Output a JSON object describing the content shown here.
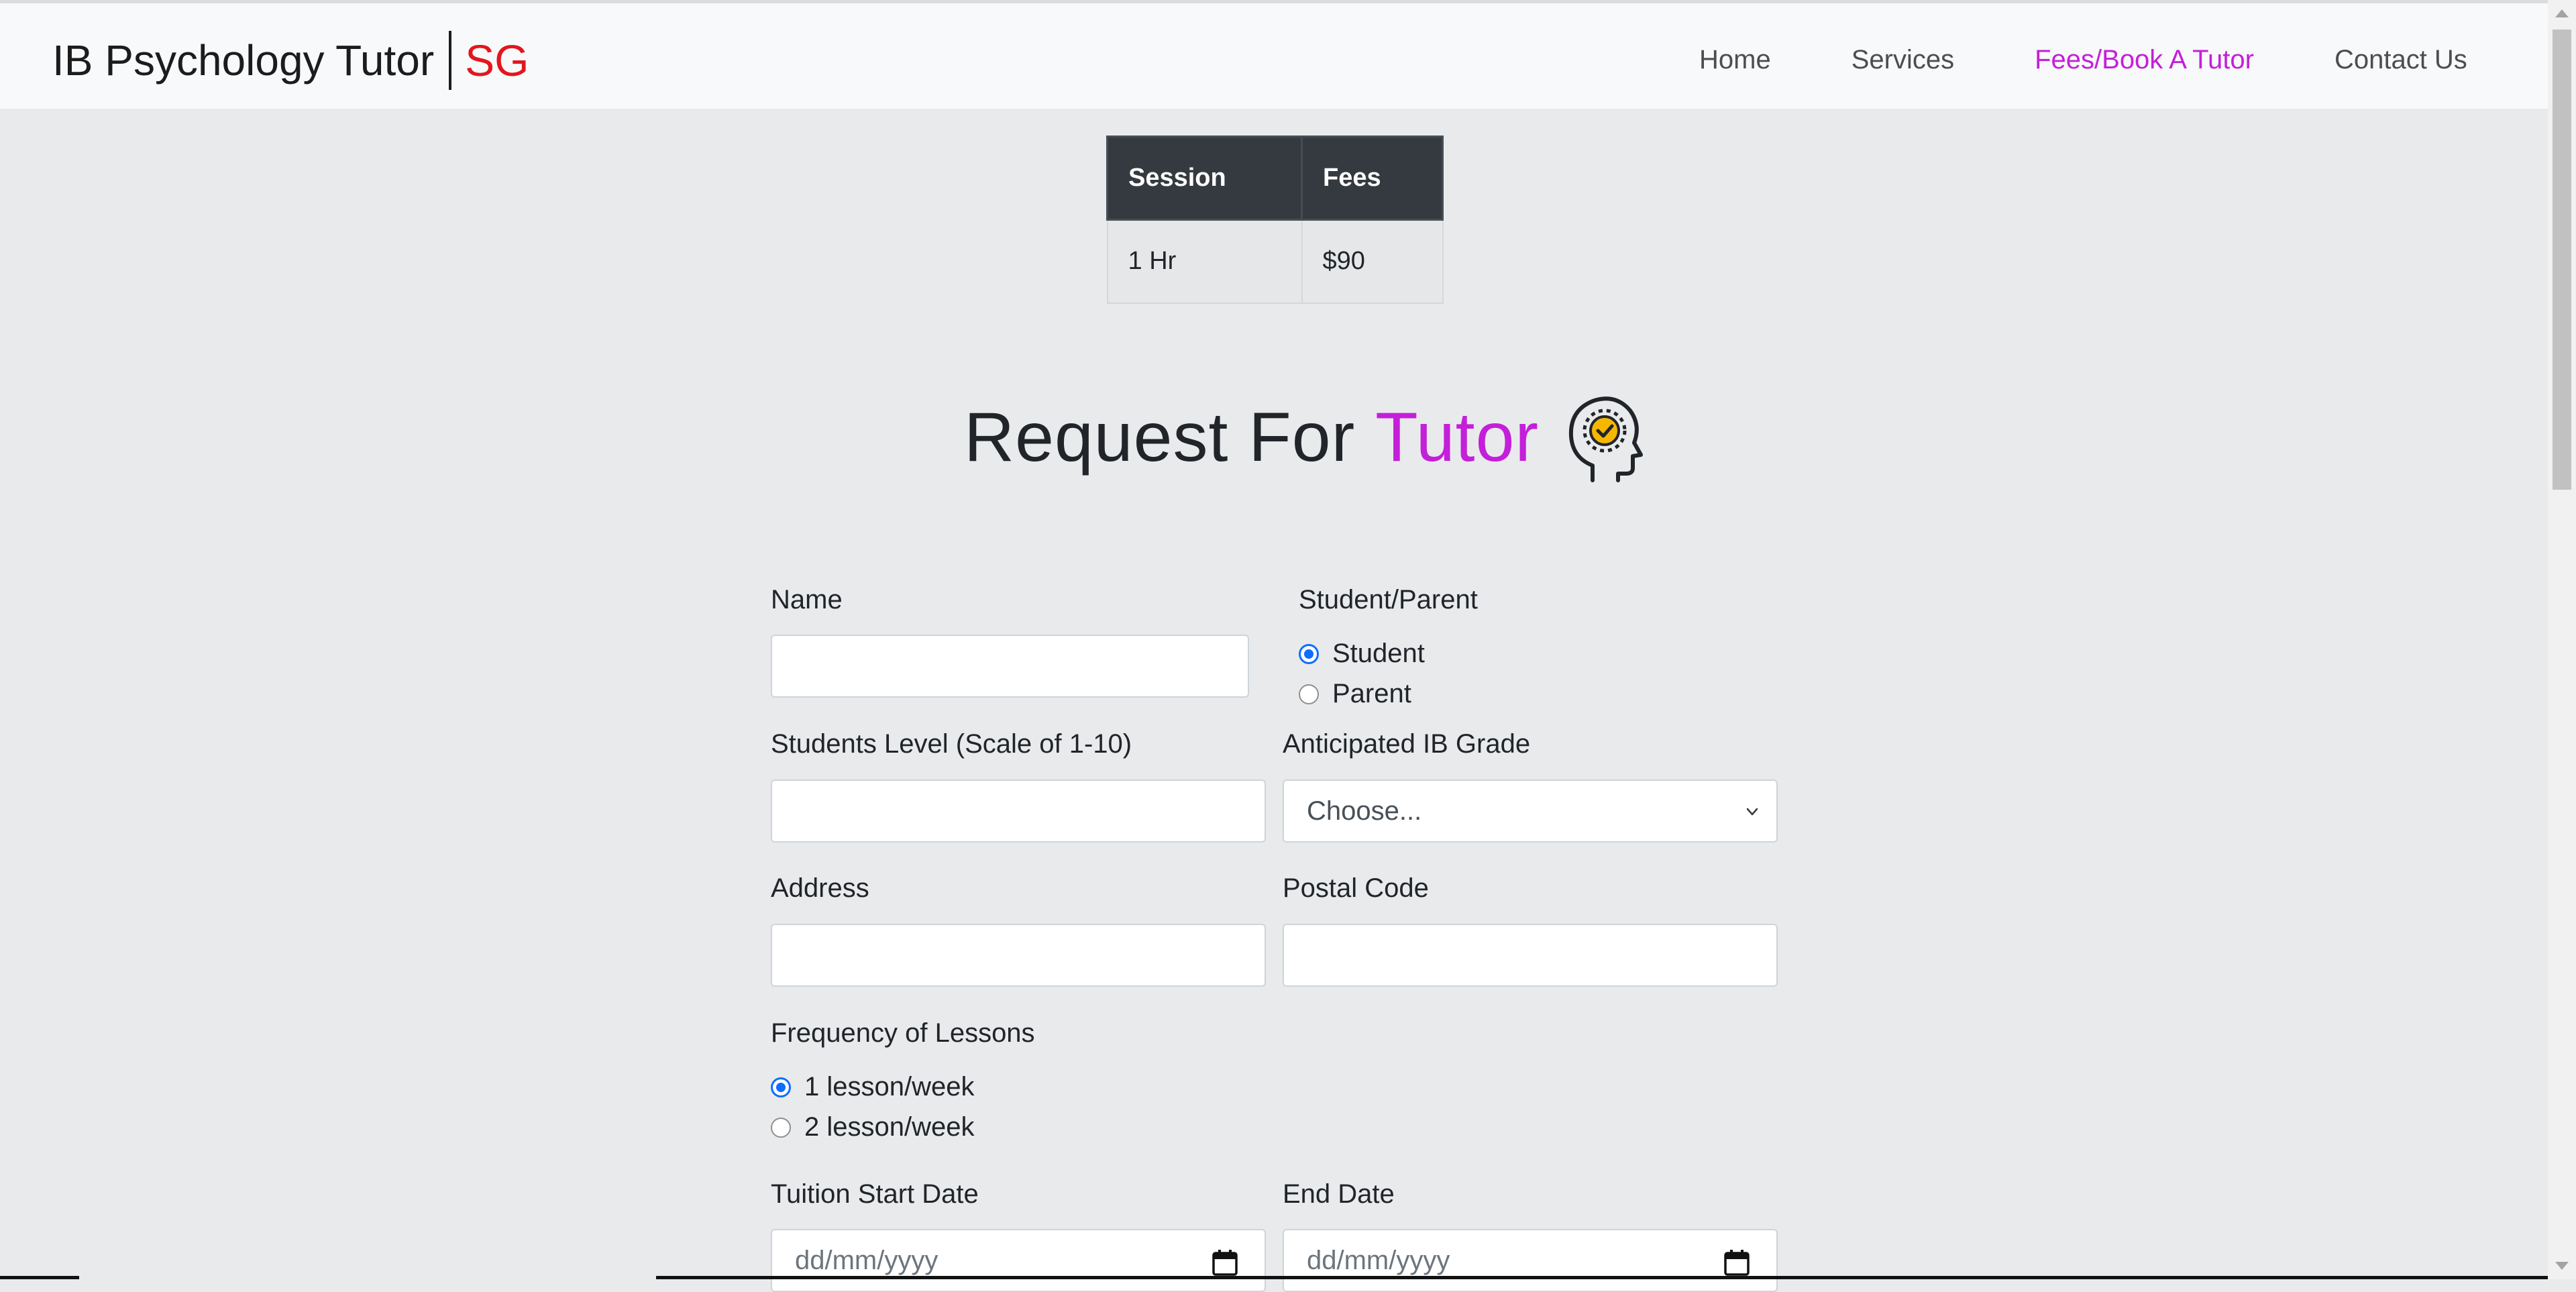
{
  "navbar": {
    "brand_name": "IB Psychology Tutor",
    "brand_suffix": "SG",
    "brand_suffix_color": "#e3161e",
    "links": [
      {
        "label": "Home",
        "active": false
      },
      {
        "label": "Services",
        "active": false
      },
      {
        "label": "Fees/Book A Tutor",
        "active": true
      },
      {
        "label": "Contact Us",
        "active": false
      }
    ],
    "active_color": "#c41fd9"
  },
  "fees_table": {
    "headers": [
      "Session",
      "Fees"
    ],
    "rows": [
      [
        "1 Hr",
        "$90"
      ]
    ]
  },
  "heading": {
    "text": "Request For",
    "accent": "Tutor",
    "icon": "head-check-icon"
  },
  "form": {
    "name_label": "Name",
    "name_value": "",
    "student_parent_label": "Student/Parent",
    "student_parent_options": [
      {
        "label": "Student",
        "checked": true
      },
      {
        "label": "Parent",
        "checked": false
      }
    ],
    "students_level_label": "Students Level (Scale of 1-10)",
    "students_level_value": "",
    "anticipated_grade_label": "Anticipated IB Grade",
    "anticipated_grade_value": "Choose...",
    "address_label": "Address",
    "address_value": "",
    "postal_code_label": "Postal Code",
    "postal_code_value": "",
    "frequency_label": "Frequency of Lessons",
    "frequency_options": [
      {
        "label": "1 lesson/week",
        "checked": true
      },
      {
        "label": "2 lesson/week",
        "checked": false
      }
    ],
    "start_date_label": "Tuition Start Date",
    "start_date_placeholder": "dd/mm/yyyy",
    "end_date_label": "End Date",
    "end_date_placeholder": "dd/mm/yyyy"
  }
}
